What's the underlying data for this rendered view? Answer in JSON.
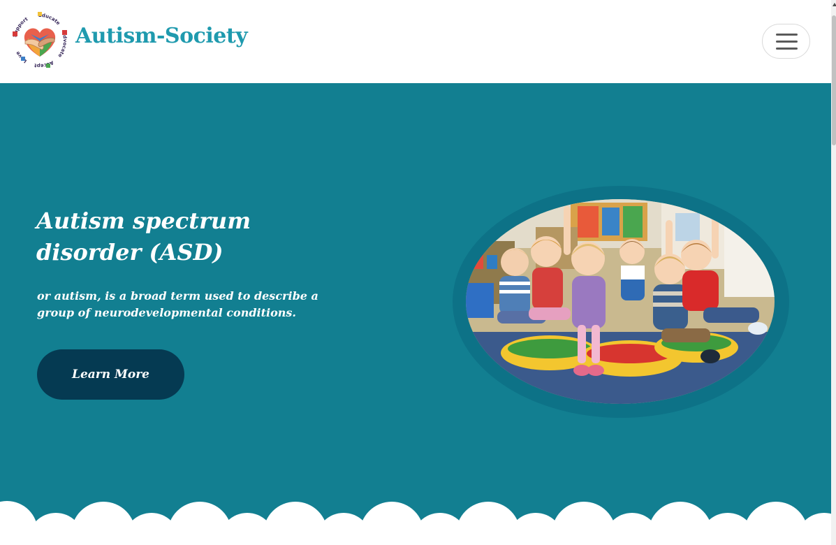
{
  "header": {
    "brand": "Autism-Society",
    "logo_words": [
      "Support",
      "Educate",
      "Advocate",
      "Accept",
      "Love"
    ],
    "menu_icon": "hamburger-icon"
  },
  "hero": {
    "title": "Autism spectrum disorder (ASD)",
    "subtitle": "or autism, is a broad term used to describe a group of neurodevelopmental conditions.",
    "cta_label": "Learn More",
    "image_alt": "children-sitting-on-cushions-raising-hands"
  },
  "colors": {
    "brand": "#1f9aae",
    "hero_bg": "#127f91",
    "button_bg": "#053a52",
    "ring": "#0d7287"
  }
}
